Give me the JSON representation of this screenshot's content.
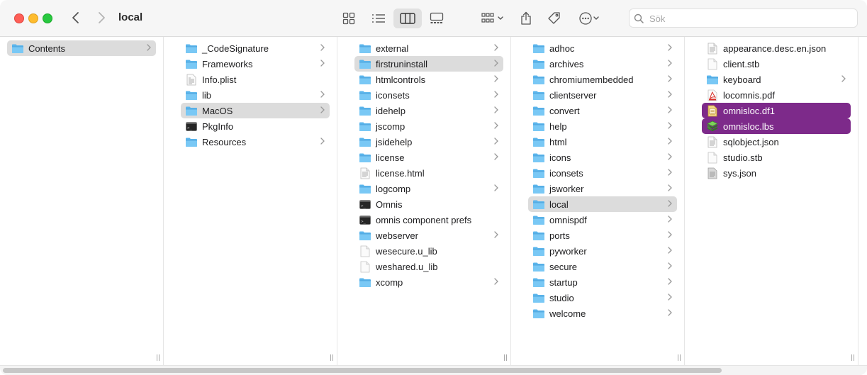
{
  "window": {
    "title": "local"
  },
  "search": {
    "placeholder": "Sök"
  },
  "colors": {
    "selection": "#dcdcdc",
    "highlight": "#7d2a8a",
    "folder": "#5ab5ec"
  },
  "columns": [
    {
      "items": [
        {
          "label": "Contents",
          "icon": "folder",
          "chevron": true,
          "state": "selected"
        }
      ]
    },
    {
      "items": [
        {
          "label": "_CodeSignature",
          "icon": "folder",
          "chevron": true
        },
        {
          "label": "Frameworks",
          "icon": "folder",
          "chevron": true
        },
        {
          "label": "Info.plist",
          "icon": "plist",
          "chevron": false
        },
        {
          "label": "lib",
          "icon": "folder",
          "chevron": true
        },
        {
          "label": "MacOS",
          "icon": "folder",
          "chevron": true,
          "state": "selected"
        },
        {
          "label": "PkgInfo",
          "icon": "terminal",
          "chevron": false
        },
        {
          "label": "Resources",
          "icon": "folder",
          "chevron": true
        }
      ]
    },
    {
      "items": [
        {
          "label": "external",
          "icon": "folder",
          "chevron": true
        },
        {
          "label": "firstruninstall",
          "icon": "folder",
          "chevron": true,
          "state": "selected"
        },
        {
          "label": "htmlcontrols",
          "icon": "folder",
          "chevron": true
        },
        {
          "label": "iconsets",
          "icon": "folder",
          "chevron": true
        },
        {
          "label": "idehelp",
          "icon": "folder",
          "chevron": true
        },
        {
          "label": "jscomp",
          "icon": "folder",
          "chevron": true
        },
        {
          "label": "jsidehelp",
          "icon": "folder",
          "chevron": true
        },
        {
          "label": "license",
          "icon": "folder",
          "chevron": true
        },
        {
          "label": "license.html",
          "icon": "doc-lines",
          "chevron": false
        },
        {
          "label": "logcomp",
          "icon": "folder",
          "chevron": true
        },
        {
          "label": "Omnis",
          "icon": "terminal",
          "chevron": false
        },
        {
          "label": "omnis component prefs",
          "icon": "terminal",
          "chevron": false
        },
        {
          "label": "webserver",
          "icon": "folder",
          "chevron": true
        },
        {
          "label": "wesecure.u_lib",
          "icon": "doc-blank",
          "chevron": false
        },
        {
          "label": "weshared.u_lib",
          "icon": "doc-blank",
          "chevron": false
        },
        {
          "label": "xcomp",
          "icon": "folder",
          "chevron": true
        }
      ]
    },
    {
      "items": [
        {
          "label": "adhoc",
          "icon": "folder",
          "chevron": true
        },
        {
          "label": "archives",
          "icon": "folder",
          "chevron": true
        },
        {
          "label": "chromiumembedded",
          "icon": "folder",
          "chevron": true
        },
        {
          "label": "clientserver",
          "icon": "folder",
          "chevron": true
        },
        {
          "label": "convert",
          "icon": "folder",
          "chevron": true
        },
        {
          "label": "help",
          "icon": "folder",
          "chevron": true
        },
        {
          "label": "html",
          "icon": "folder",
          "chevron": true
        },
        {
          "label": "icons",
          "icon": "folder",
          "chevron": true
        },
        {
          "label": "iconsets",
          "icon": "folder",
          "chevron": true
        },
        {
          "label": "jsworker",
          "icon": "folder",
          "chevron": true
        },
        {
          "label": "local",
          "icon": "folder",
          "chevron": true,
          "state": "selected"
        },
        {
          "label": "omnispdf",
          "icon": "folder",
          "chevron": true
        },
        {
          "label": "ports",
          "icon": "folder",
          "chevron": true
        },
        {
          "label": "pyworker",
          "icon": "folder",
          "chevron": true
        },
        {
          "label": "secure",
          "icon": "folder",
          "chevron": true
        },
        {
          "label": "startup",
          "icon": "folder",
          "chevron": true
        },
        {
          "label": "studio",
          "icon": "folder",
          "chevron": true
        },
        {
          "label": "welcome",
          "icon": "folder",
          "chevron": true
        }
      ]
    },
    {
      "items": [
        {
          "label": "appearance.desc.en.json",
          "icon": "doc-lines",
          "chevron": false
        },
        {
          "label": "client.stb",
          "icon": "doc-blank",
          "chevron": false
        },
        {
          "label": "keyboard",
          "icon": "folder",
          "chevron": true
        },
        {
          "label": "locomnis.pdf",
          "icon": "pdf",
          "chevron": false
        },
        {
          "label": "omnisloc.df1",
          "icon": "df1",
          "chevron": false,
          "state": "highlighted"
        },
        {
          "label": "omnisloc.lbs",
          "icon": "lbs",
          "chevron": false,
          "state": "highlighted"
        },
        {
          "label": "sqlobject.json",
          "icon": "doc-lines",
          "chevron": false
        },
        {
          "label": "studio.stb",
          "icon": "doc-blank",
          "chevron": false
        },
        {
          "label": "sys.json",
          "icon": "doc-gray",
          "chevron": false
        }
      ]
    }
  ]
}
